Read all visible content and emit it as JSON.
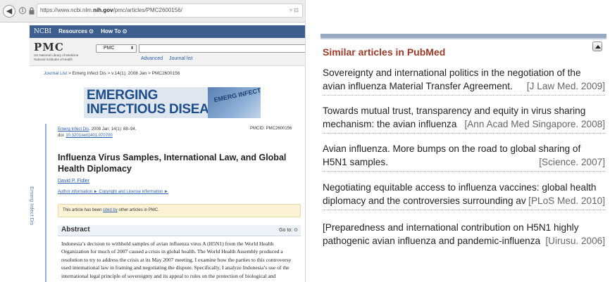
{
  "browser": {
    "url_prefix": "https://www.ncbi.nlm.",
    "url_host": "nih.gov",
    "url_suffix": "/pmc/articles/PMC2600156/",
    "url_tail": "▿ ⊡"
  },
  "ncbi_bar": {
    "logo": "NCBI",
    "resources": "Resources ⊙",
    "howto": "How To ⊙"
  },
  "pmc_bar": {
    "logo": "PMC",
    "subtitle": "US National Library of Medicine National Institutes of Health",
    "db_select": "PMC",
    "advanced": "Advanced",
    "journal_list": "Journal list"
  },
  "breadcrumb": {
    "journal_list": "Journal List",
    "rest": " > Emerg Infect Dis > v.14(1); 2008 Jan > PMC2600156"
  },
  "banner": {
    "line1": "EMERGING",
    "line2": "INFECTIOUS DISEASES",
    "cover_text": "EMERG INFECTI"
  },
  "article": {
    "side_label": "Emerg Infect Dis",
    "journal_link": "Emerg Infect Dis",
    "citation": ". 2008 Jan; 14(1): 88–94.",
    "doi_label": "doi: ",
    "doi": "10.3201/eid1401.070700",
    "pmcid": "PMCID: PMC2600156",
    "title": "Influenza Virus Samples, International Law, and Global Health Diplomacy",
    "author": "David P. Fidler",
    "author_info": "Author information ► ",
    "copyright": "Copyright and License information ►",
    "cited_pre": "This article has been ",
    "cited_link": "cited by",
    "cited_post": " other articles in PMC.",
    "abstract_heading": "Abstract",
    "goto": "Go to: ⊙",
    "abstract_text": "Indonesia’s decision to withhold samples of avian influenza virus A (H5N1) from the World Health Organization for much of 2007 caused a crisis in global health. The World Health Assembly produced a resolution to try to address the crisis at its May 2007 meeting. I examine how the parties to this controversy used international law in framing and negotiating the dispute. Specifically, I analyze Indonesia’s use of the international legal principle of sovereignty and its appeal to rules on the protection of biological and"
  },
  "similar": {
    "title": "Similar articles in PubMed",
    "items": [
      {
        "line1": "Sovereignty and international politics in the negotiation of the",
        "line2": "avian influenza Material Transfer Agreement.",
        "source": "[J Law Med. 2009]"
      },
      {
        "line1": "Towards mutual trust, transparency and equity in virus sharing",
        "line2": "mechanism: the avian influenza",
        "source": "[Ann Acad Med Singapore. 2008]"
      },
      {
        "line1": "Avian influenza. More bumps on the road to global sharing of",
        "line2": "H5N1 samples.",
        "source": "[Science. 2007]"
      },
      {
        "line1": "Negotiating equitable access to influenza vaccines: global health",
        "line2": "diplomacy and the controversies surrounding av",
        "source": "[PLoS Med. 2010]"
      },
      {
        "line1": "[Preparedness and international contribution on H5N1 highly",
        "line2": "pathogenic avian influenza and pandemic-influenza",
        "source": "[Uirusu. 2006]"
      }
    ]
  }
}
